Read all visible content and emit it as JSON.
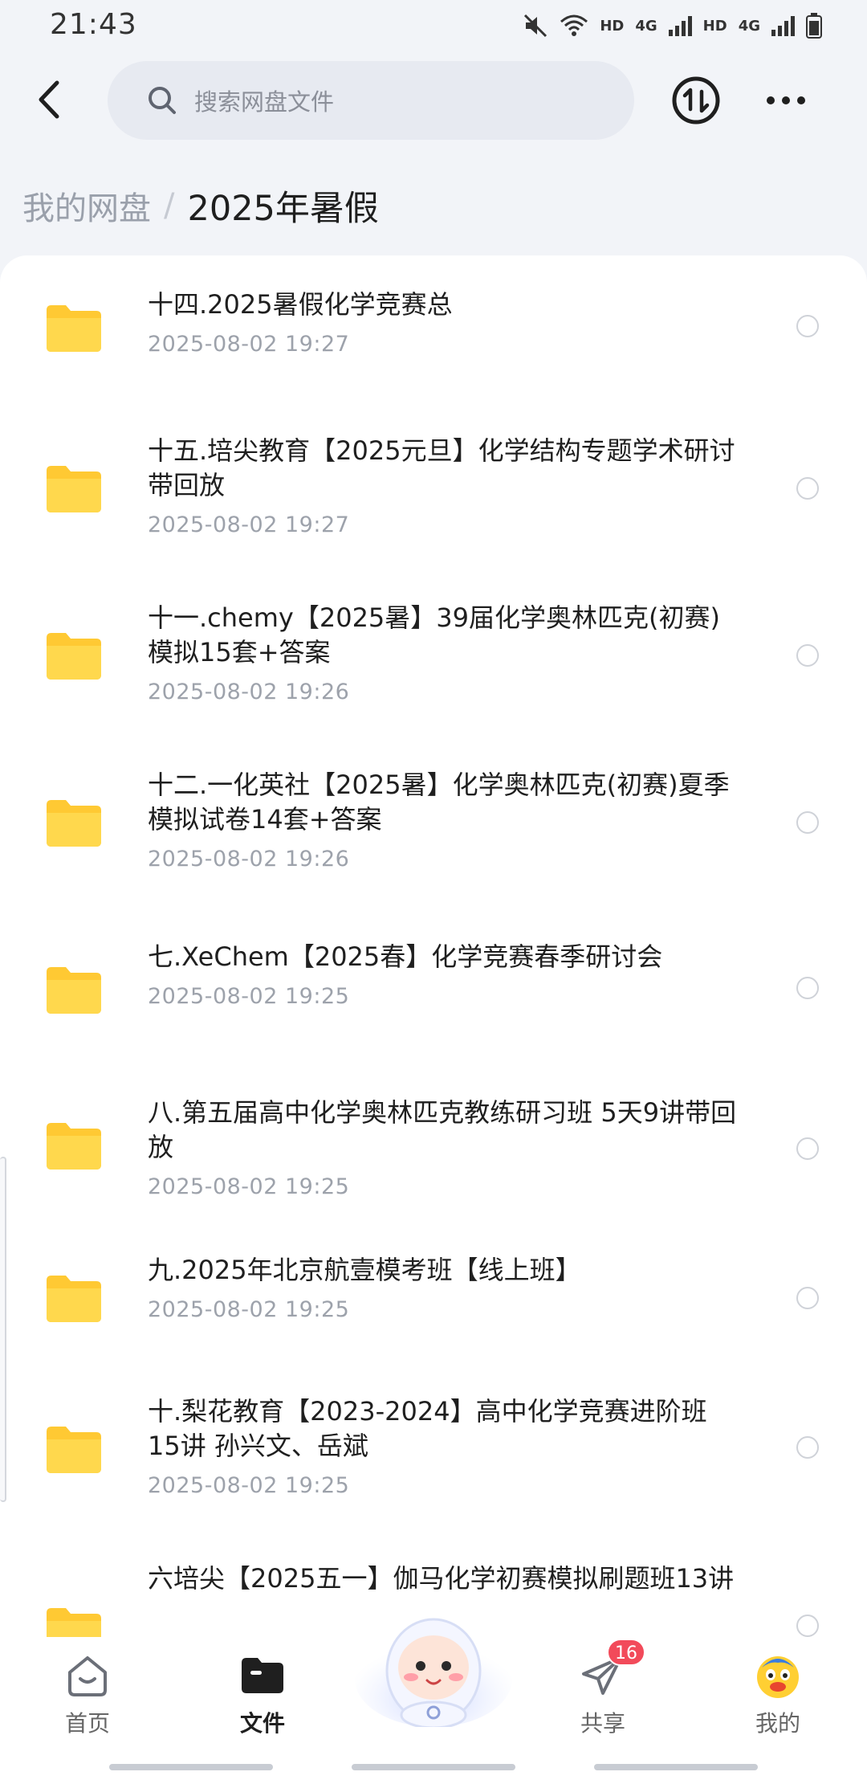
{
  "status_bar": {
    "time": "21:43",
    "network_label_1": "HD",
    "network_gen_1": "4G",
    "network_label_2": "HD",
    "network_gen_2": "4G"
  },
  "top_bar": {
    "search_placeholder": "搜索网盘文件"
  },
  "breadcrumb": {
    "root": "我的网盘",
    "separator": "/",
    "current": "2025年暑假"
  },
  "files": [
    {
      "name": "十四.2025暑假化学竞赛总",
      "date": "2025-08-02  19:27"
    },
    {
      "name": "十五.培尖教育【2025元旦】化学结构专题学术研讨带回放",
      "date": "2025-08-02  19:27"
    },
    {
      "name": "十一.chemy【2025暑】39届化学奥林匹克(初赛)模拟15套+答案",
      "date": "2025-08-02  19:26"
    },
    {
      "name": "十二.一化英社【2025暑】化学奥林匹克(初赛)夏季模拟试卷14套+答案",
      "date": "2025-08-02  19:26"
    },
    {
      "name": "七.XeChem【2025春】化学竞赛春季研讨会",
      "date": "2025-08-02  19:25"
    },
    {
      "name": "八.第五届高中化学奥林匹克教练研习班 5天9讲带回放",
      "date": "2025-08-02  19:25"
    },
    {
      "name": "九.2025年北京航壹模考班【线上班】",
      "date": "2025-08-02  19:25"
    },
    {
      "name": "十.梨花教育【2023-2024】高中化学竞赛进阶班 15讲 孙兴文、岳斌",
      "date": "2025-08-02  19:25"
    },
    {
      "name": "六培尖【2025五一】伽马化学初赛模拟刷题班13讲",
      "date": ""
    }
  ],
  "bottom_nav": {
    "home": "首页",
    "files": "文件",
    "share": "共享",
    "share_badge": "16",
    "mine": "我的"
  },
  "colors": {
    "folder": "#ffc933",
    "accent_badge": "#f24a5a",
    "background": "#f2f4f8"
  }
}
